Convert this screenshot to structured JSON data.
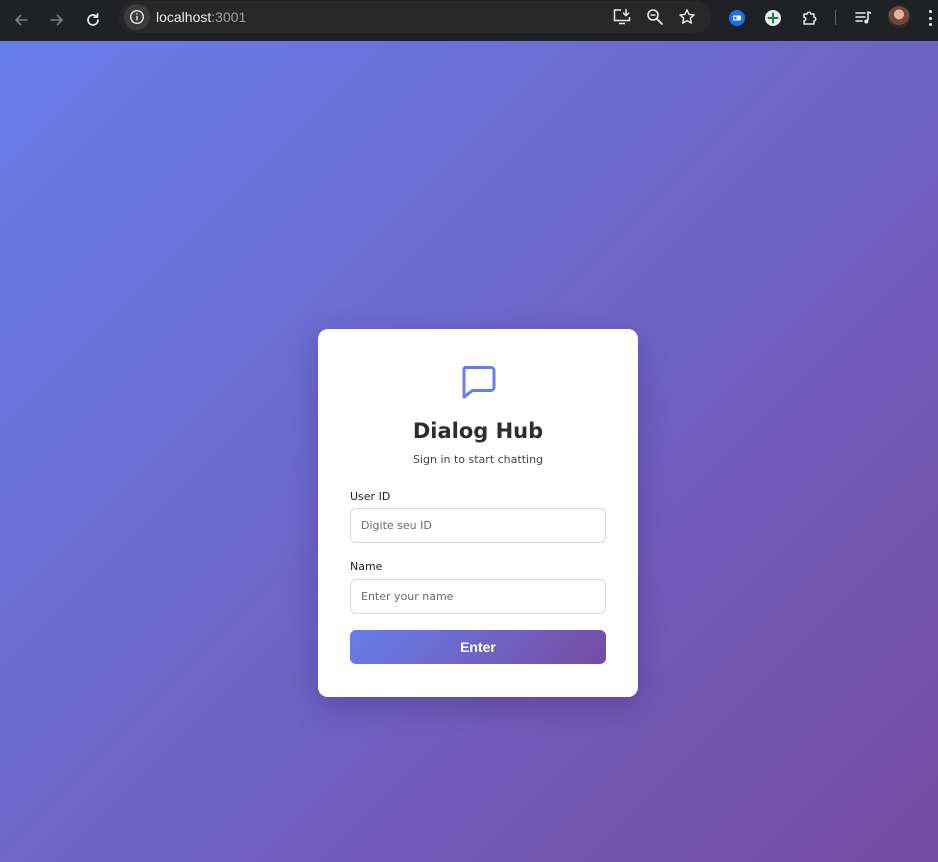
{
  "browser": {
    "url_host": "localhost",
    "url_port": ":3001",
    "icons": {
      "back": "arrow-left-icon",
      "forward": "arrow-right-icon",
      "reload": "reload-icon",
      "site_info": "info-icon",
      "install_app": "install-app-icon",
      "zoom": "zoom-icon",
      "bookmark": "star-icon",
      "extensions": "puzzle-icon",
      "reading_list": "reading-list-icon",
      "menu": "more-vert-icon"
    }
  },
  "login": {
    "title": "Dialog Hub",
    "subtitle": "Sign in to start chatting",
    "user_id_label": "User ID",
    "user_id_placeholder": "Digite seu ID",
    "user_id_value": "",
    "name_label": "Name",
    "name_placeholder": "Enter your name",
    "name_value": "",
    "submit_label": "Enter",
    "logo_icon": "chat-bubble-icon"
  },
  "colors": {
    "gradient_start": "#667eea",
    "gradient_end": "#764ba2",
    "chrome_bg": "#202124",
    "card_bg": "#ffffff"
  }
}
